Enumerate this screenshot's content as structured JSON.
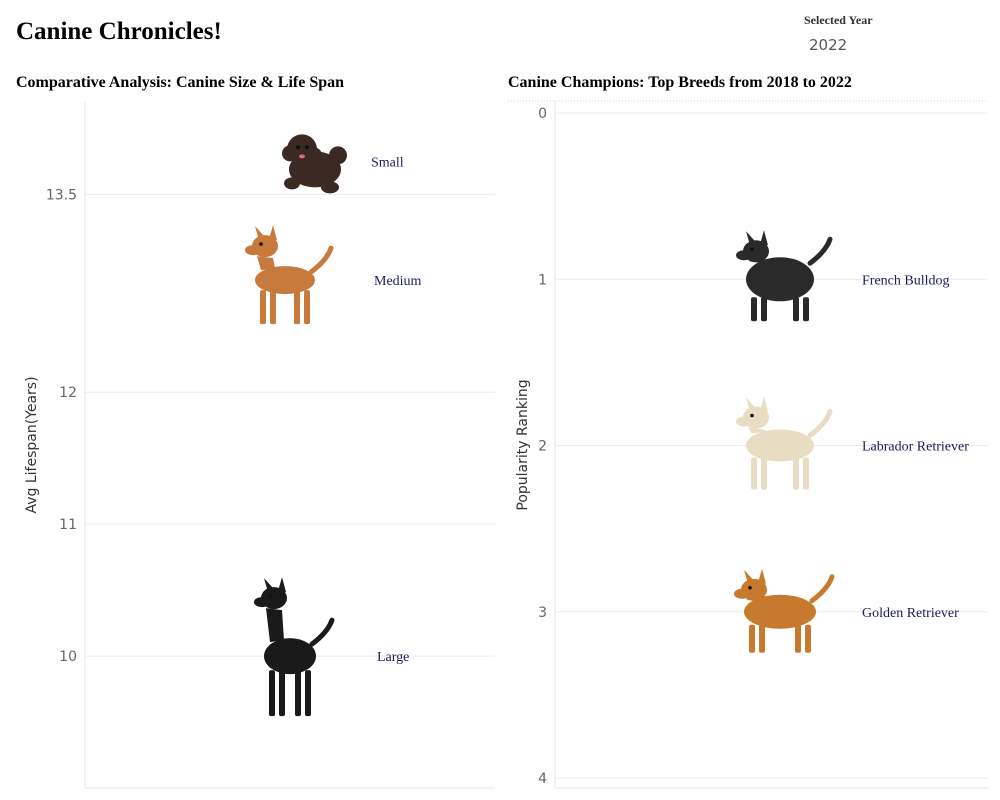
{
  "page": {
    "title": "Canine Chronicles!"
  },
  "filter": {
    "label": "Selected Year",
    "value": "2022"
  },
  "chart_data": [
    {
      "type": "scatter",
      "title": "Comparative Analysis: Canine Size & Life Span",
      "ylabel": "Avg Lifespan(Years)",
      "xlabel": "",
      "ylim": [
        9,
        14.2
      ],
      "y_ticks": [
        10,
        11,
        12,
        13.5
      ],
      "grid": true,
      "points": [
        {
          "label": "Small",
          "y": 13.75,
          "icon": "small-dog-icon"
        },
        {
          "label": "Medium",
          "y": 12.85,
          "icon": "medium-dog-icon"
        },
        {
          "label": "Large",
          "y": 10.0,
          "icon": "large-dog-icon"
        }
      ]
    },
    {
      "type": "scatter",
      "title": "Canine Champions: Top Breeds from 2018 to 2022",
      "ylabel": "Popularity Ranking",
      "xlabel": "",
      "ylim": [
        0,
        4
      ],
      "y_reversed": true,
      "y_ticks": [
        0,
        1,
        2,
        3,
        4
      ],
      "grid": true,
      "points": [
        {
          "label": "French Bulldog",
          "y": 1,
          "icon": "french-bulldog-icon"
        },
        {
          "label": "Labrador Retriever",
          "y": 2,
          "icon": "labrador-retriever-icon"
        },
        {
          "label": "Golden Retriever",
          "y": 3,
          "icon": "golden-retriever-icon"
        }
      ]
    }
  ]
}
